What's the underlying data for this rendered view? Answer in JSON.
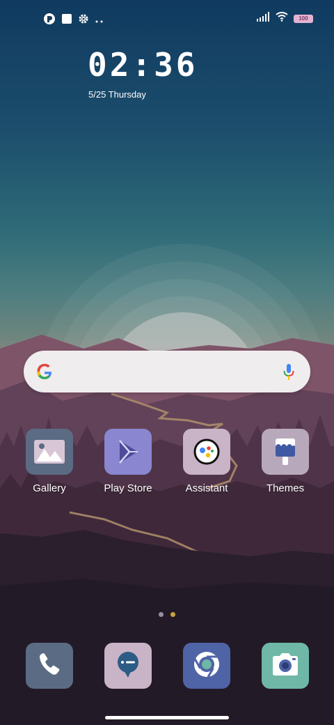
{
  "status_bar": {
    "battery_text": "100",
    "left_icons": [
      "app-notification-icon",
      "square-notification-icon",
      "settings-icon",
      "more-dots-icon"
    ],
    "right_icons": [
      "signal-icon",
      "wifi-icon",
      "battery-icon"
    ]
  },
  "lock": {
    "time": "02:36",
    "date": "5/25 Thursday"
  },
  "search": {
    "icons": [
      "google-logo-icon",
      "microphone-icon"
    ]
  },
  "apps": [
    {
      "label": "Gallery",
      "color": "#5b6b84",
      "icon": "gallery-icon"
    },
    {
      "label": "Play Store",
      "color": "#8a86cf",
      "icon": "play-store-icon"
    },
    {
      "label": "Assistant",
      "color": "#c9b3c6",
      "icon": "assistant-icon"
    },
    {
      "label": "Themes",
      "color": "#b8a8bb",
      "icon": "themes-icon"
    }
  ],
  "page_indicator": {
    "count": 2,
    "active": 2
  },
  "dock": [
    {
      "name": "phone",
      "color": "#5b6b84",
      "icon": "phone-icon"
    },
    {
      "name": "messages",
      "color": "#c9b3c6",
      "icon": "messages-icon"
    },
    {
      "name": "chrome",
      "color": "#4f64a7",
      "icon": "chrome-icon"
    },
    {
      "name": "camera",
      "color": "#6fb7a6",
      "icon": "camera-icon"
    }
  ]
}
